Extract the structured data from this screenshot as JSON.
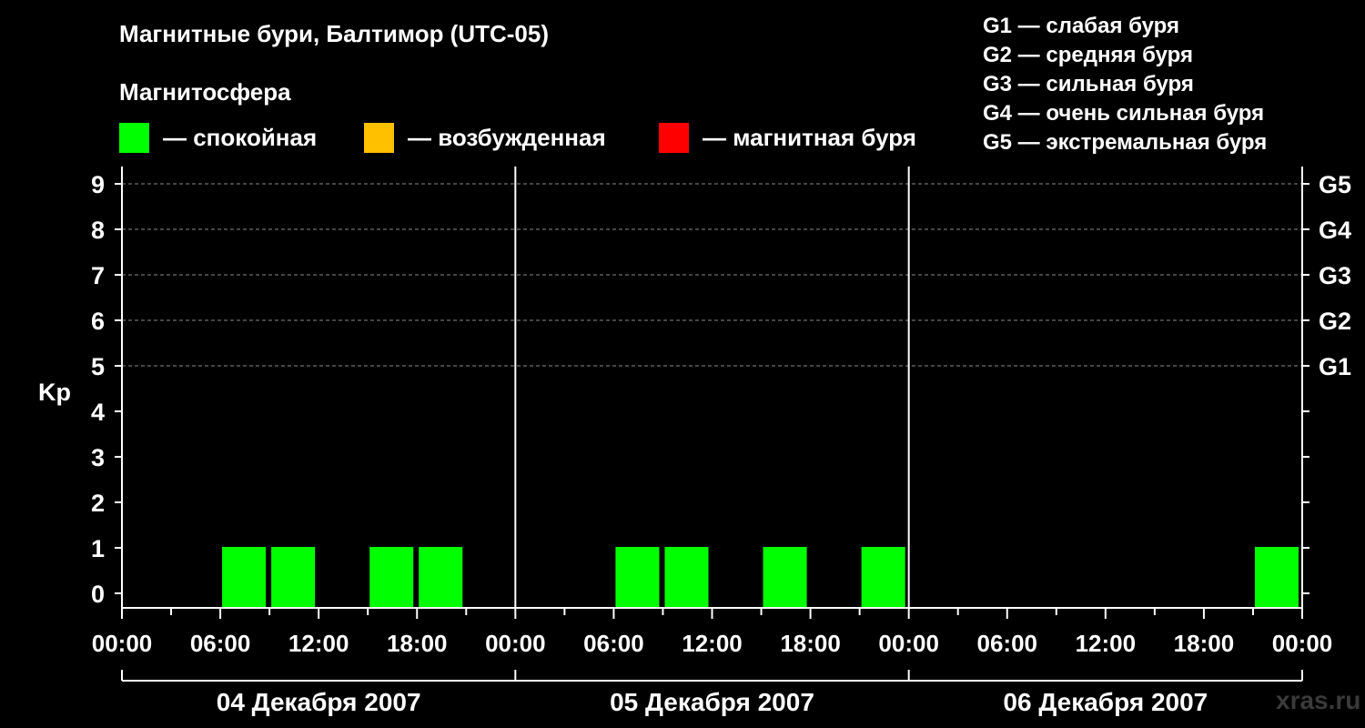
{
  "header": {
    "title": "Магнитные бури, Балтимор (UTC-05)",
    "subtitle": "Магнитосфера"
  },
  "legend": [
    {
      "color": "#00ff00",
      "label": "— спокойная"
    },
    {
      "color": "#ffc000",
      "label": "— возбужденная"
    },
    {
      "color": "#ff0000",
      "label": "— магнитная буря"
    }
  ],
  "g_scale": [
    "G1 — слабая буря",
    "G2 — средняя буря",
    "G3 — сильная буря",
    "G4 — очень сильная буря",
    "G5 — экстремальная буря"
  ],
  "watermark": "xras.ru",
  "chart_data": {
    "type": "bar",
    "title": "Магнитные бури, Балтимор (UTC-05)",
    "ylabel": "Kp",
    "ylim": [
      0,
      9
    ],
    "yticks": [
      0,
      1,
      2,
      3,
      4,
      5,
      6,
      7,
      8,
      9
    ],
    "right_labels": [
      {
        "kp": 5,
        "label": "G1"
      },
      {
        "kp": 6,
        "label": "G2"
      },
      {
        "kp": 7,
        "label": "G3"
      },
      {
        "kp": 8,
        "label": "G4"
      },
      {
        "kp": 9,
        "label": "G5"
      }
    ],
    "xtick_labels": [
      "00:00",
      "06:00",
      "12:00",
      "18:00",
      "00:00",
      "06:00",
      "12:00",
      "18:00",
      "00:00",
      "06:00",
      "12:00",
      "18:00",
      "00:00"
    ],
    "days": [
      "04 Декабря 2007",
      "05 Декабря 2007",
      "06 Декабря 2007"
    ],
    "grid": true,
    "interval_hours": 3,
    "series": [
      {
        "values": [
          {
            "day": "04 Декабря 2007",
            "start": "06:00",
            "kp": 1,
            "level": "спокойная"
          },
          {
            "day": "04 Декабря 2007",
            "start": "09:00",
            "kp": 1,
            "level": "спокойная"
          },
          {
            "day": "04 Декабря 2007",
            "start": "15:00",
            "kp": 1,
            "level": "спокойная"
          },
          {
            "day": "04 Декабря 2007",
            "start": "18:00",
            "kp": 1,
            "level": "спокойная"
          },
          {
            "day": "05 Декабря 2007",
            "start": "06:00",
            "kp": 1,
            "level": "спокойная"
          },
          {
            "day": "05 Декабря 2007",
            "start": "09:00",
            "kp": 1,
            "level": "спокойная"
          },
          {
            "day": "05 Декабря 2007",
            "start": "15:00",
            "kp": 1,
            "level": "спокойная"
          },
          {
            "day": "05 Декабря 2007",
            "start": "21:00",
            "kp": 1,
            "level": "спокойная"
          },
          {
            "day": "06 Декабря 2007",
            "start": "21:00",
            "kp": 1,
            "level": "спокойная"
          }
        ]
      }
    ]
  }
}
